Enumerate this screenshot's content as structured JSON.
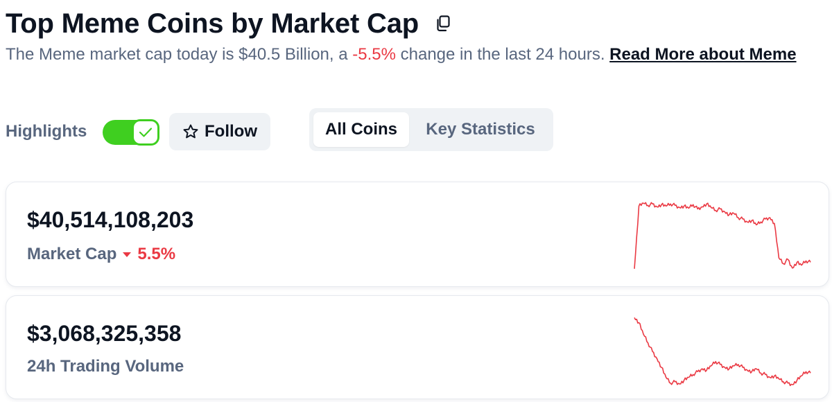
{
  "header": {
    "title": "Top Meme Coins by Market Cap",
    "copy_icon": "copy-icon"
  },
  "description": {
    "prefix": "The Meme market cap today is $40.5 Billion, a ",
    "change": "-5.5%",
    "suffix": " change in the last 24 hours. ",
    "read_more": "Read More about Meme"
  },
  "controls": {
    "highlights_label": "Highlights",
    "highlights_on": true,
    "follow_label": "Follow",
    "follow_icon": "star-outline-icon",
    "tabs": [
      {
        "label": "All Coins",
        "active": true
      },
      {
        "label": "Key Statistics",
        "active": false
      }
    ]
  },
  "cards": [
    {
      "value": "$40,514,108,203",
      "label": "Market Cap",
      "change": "5.5%",
      "direction": "down",
      "sparkline": [
        0.05,
        0.92,
        0.96,
        0.93,
        0.95,
        0.91,
        0.94,
        0.92,
        0.95,
        0.93,
        0.9,
        0.92,
        0.89,
        0.94,
        0.88,
        0.91,
        0.95,
        0.9,
        0.86,
        0.88,
        0.84,
        0.8,
        0.82,
        0.76,
        0.74,
        0.7,
        0.72,
        0.66,
        0.7,
        0.74,
        0.76,
        0.68,
        0.2,
        0.12,
        0.18,
        0.06,
        0.14,
        0.1,
        0.16,
        0.14
      ]
    },
    {
      "value": "$3,068,325,358",
      "label": "24h Trading Volume",
      "change": "",
      "direction": "",
      "sparkline": [
        0.95,
        0.88,
        0.72,
        0.6,
        0.48,
        0.38,
        0.26,
        0.12,
        0.04,
        0.06,
        0.03,
        0.08,
        0.12,
        0.16,
        0.2,
        0.24,
        0.22,
        0.28,
        0.34,
        0.3,
        0.26,
        0.24,
        0.28,
        0.3,
        0.26,
        0.22,
        0.2,
        0.24,
        0.18,
        0.16,
        0.12,
        0.14,
        0.1,
        0.06,
        0.04,
        0.02,
        0.08,
        0.14,
        0.2,
        0.18
      ]
    }
  ],
  "colors": {
    "negative": "#ea3943",
    "toggle_on": "#3fcf20",
    "muted_text": "#58667e",
    "sparkline": "#ea3943"
  }
}
